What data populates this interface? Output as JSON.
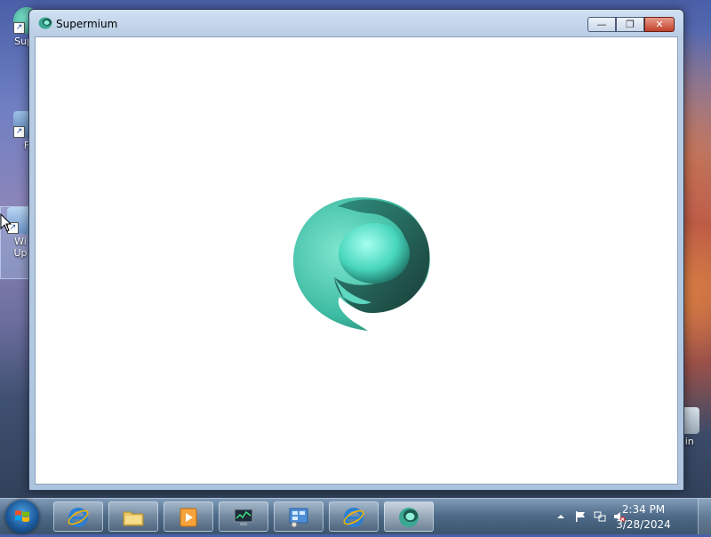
{
  "desktop": {
    "icons": [
      {
        "label": "Supe"
      },
      {
        "label": "F"
      },
      {
        "label": "Wi\nUp"
      },
      {
        "label": "Bin"
      }
    ]
  },
  "window": {
    "title": "Supermium",
    "buttons": {
      "minimize": "—",
      "maximize": "❐",
      "close": "✕"
    },
    "logo_icon": "supermium-logo-icon"
  },
  "taskbar": {
    "start_icon": "windows-start-icon",
    "pinned": [
      {
        "name": "internet-explorer",
        "icon": "ie-icon"
      },
      {
        "name": "explorer",
        "icon": "folder-icon"
      },
      {
        "name": "media-player",
        "icon": "media-player-icon"
      },
      {
        "name": "task-manager",
        "icon": "monitor-icon"
      },
      {
        "name": "control-panel",
        "icon": "control-panel-icon"
      },
      {
        "name": "internet-explorer-2",
        "icon": "ie-icon"
      },
      {
        "name": "supermium",
        "icon": "supermium-icon"
      }
    ],
    "tray": {
      "time": "2:34 PM",
      "date": "3/28/2024"
    }
  },
  "colors": {
    "logo_light": "#7fe6cf",
    "logo_dark": "#2f7f70",
    "close_red": "#c2412d"
  }
}
